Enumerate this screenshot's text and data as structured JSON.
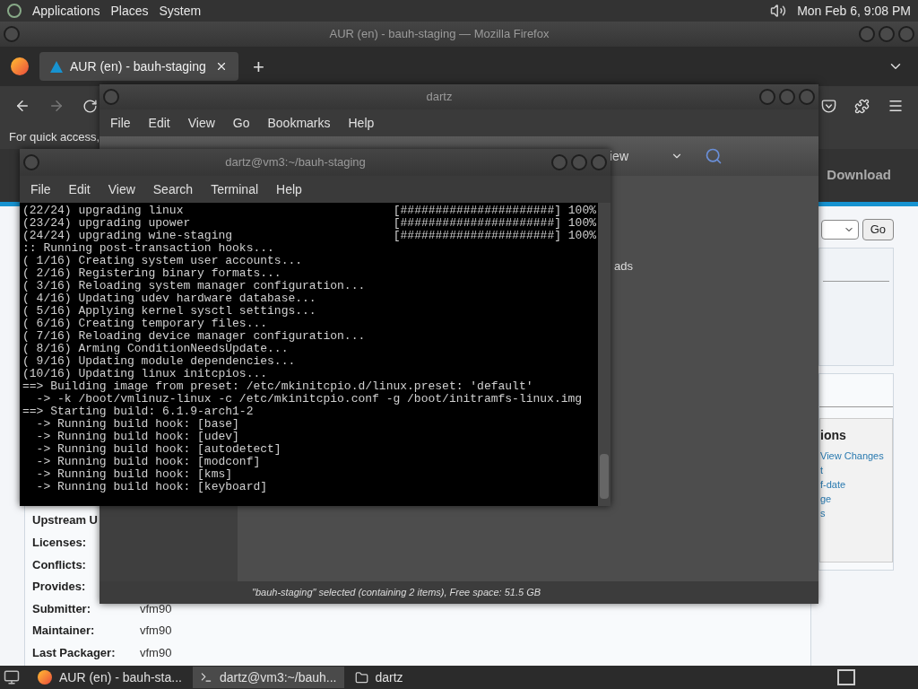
{
  "top_panel": {
    "menus": [
      "Applications",
      "Places",
      "System"
    ],
    "clock": "Mon Feb 6, 9:08 PM"
  },
  "firefox": {
    "title": "AUR (en) - bauh-staging — Mozilla Firefox",
    "tabs": [
      {
        "label": "AUR (en) - bauh-staging",
        "selected": true
      }
    ],
    "new_tab": "+",
    "bookmarks_hint": "For quick access,",
    "page": {
      "nav": [
        "Download"
      ],
      "go_button": "Go",
      "actions_heading": "ions",
      "action_links": [
        "View Changes",
        "t",
        "f-date",
        "ge",
        "s"
      ],
      "details": [
        {
          "label": "Upstream U"
        },
        {
          "label": "Licenses:"
        },
        {
          "label": "Conflicts:"
        },
        {
          "label": "Provides:"
        },
        {
          "label": "Submitter:",
          "value": "vfm90"
        },
        {
          "label": "Maintainer:",
          "value": "vfm90"
        },
        {
          "label": "Last Packager:",
          "value": "vfm90"
        }
      ]
    }
  },
  "file_manager": {
    "title": "dartz",
    "menu": [
      "File",
      "Edit",
      "View",
      "Go",
      "Bookmarks",
      "Help"
    ],
    "view_label": "iew",
    "places_item": "ads",
    "status": "\"bauh-staging\" selected (containing 2 items), Free space: 51.5 GB"
  },
  "terminal": {
    "title": "dartz@vm3:~/bauh-staging",
    "menu": [
      "File",
      "Edit",
      "View",
      "Search",
      "Terminal",
      "Help"
    ],
    "lines": [
      {
        "text": "(22/24) upgrading linux",
        "progress": "[######################] 100%"
      },
      {
        "text": "(23/24) upgrading upower",
        "progress": "[######################] 100%"
      },
      {
        "text": "(24/24) upgrading wine-staging",
        "progress": "[######################] 100%"
      },
      {
        "text": ":: Running post-transaction hooks..."
      },
      {
        "text": "( 1/16) Creating system user accounts..."
      },
      {
        "text": "( 2/16) Registering binary formats..."
      },
      {
        "text": "( 3/16) Reloading system manager configuration..."
      },
      {
        "text": "( 4/16) Updating udev hardware database..."
      },
      {
        "text": "( 5/16) Applying kernel sysctl settings..."
      },
      {
        "text": "( 6/16) Creating temporary files..."
      },
      {
        "text": "( 7/16) Reloading device manager configuration..."
      },
      {
        "text": "( 8/16) Arming ConditionNeedsUpdate..."
      },
      {
        "text": "( 9/16) Updating module dependencies..."
      },
      {
        "text": "(10/16) Updating linux initcpios..."
      },
      {
        "text": "==> Building image from preset: /etc/mkinitcpio.d/linux.preset: 'default'"
      },
      {
        "text": "  -> -k /boot/vmlinuz-linux -c /etc/mkinitcpio.conf -g /boot/initramfs-linux.img"
      },
      {
        "text": "==> Starting build: 6.1.9-arch1-2"
      },
      {
        "text": "  -> Running build hook: [base]"
      },
      {
        "text": "  -> Running build hook: [udev]"
      },
      {
        "text": "  -> Running build hook: [autodetect]"
      },
      {
        "text": "  -> Running build hook: [modconf]"
      },
      {
        "text": "  -> Running build hook: [kms]"
      },
      {
        "text": "  -> Running build hook: [keyboard]"
      }
    ]
  },
  "taskbar": {
    "items": [
      {
        "kind": "browser",
        "label": "AUR (en) - bauh-sta...",
        "selected": false
      },
      {
        "kind": "terminal",
        "label": "dartz@vm3:~/bauh...",
        "selected": true
      },
      {
        "kind": "folder",
        "label": "dartz",
        "selected": false
      }
    ]
  }
}
